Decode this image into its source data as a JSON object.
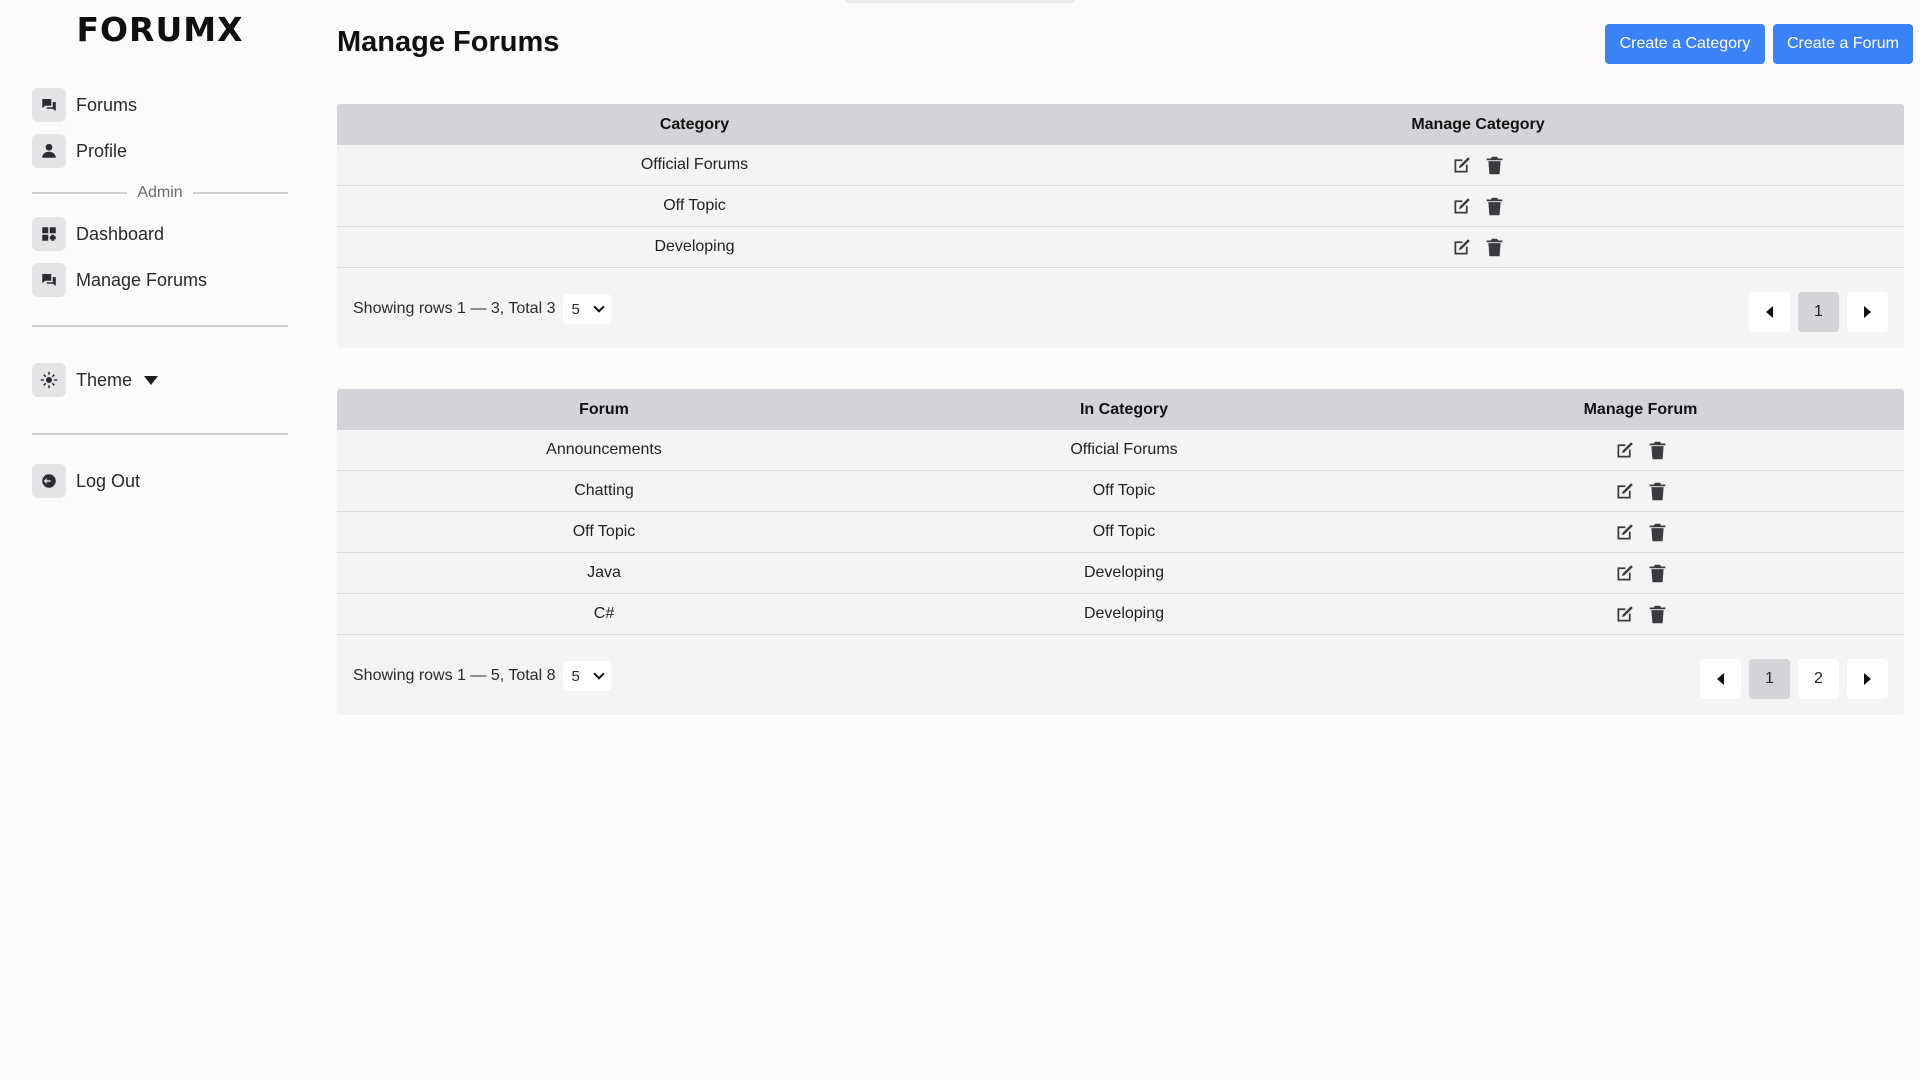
{
  "app": {
    "logo": "FORUMX"
  },
  "sidebar": {
    "items": [
      {
        "label": "Forums",
        "icon": "forums-icon"
      },
      {
        "label": "Profile",
        "icon": "user-icon"
      }
    ],
    "admin_label": "Admin",
    "admin_items": [
      {
        "label": "Dashboard",
        "icon": "dashboard-icon"
      },
      {
        "label": "Manage Forums",
        "icon": "forums-icon"
      }
    ],
    "theme_label": "Theme",
    "logout_label": "Log Out"
  },
  "header": {
    "title": "Manage Forums",
    "create_category_label": "Create a Category",
    "create_forum_label": "Create a Forum"
  },
  "categories_table": {
    "columns": [
      "Category",
      "Manage Category"
    ],
    "rows": [
      {
        "category": "Official Forums"
      },
      {
        "category": "Off Topic"
      },
      {
        "category": "Developing"
      }
    ],
    "showing": "Showing rows 1 — 3, Total 3",
    "page_size": "5",
    "pages": [
      "1"
    ],
    "current_page": "1"
  },
  "forums_table": {
    "columns": [
      "Forum",
      "In Category",
      "Manage Forum"
    ],
    "rows": [
      {
        "forum": "Announcements",
        "category": "Official Forums"
      },
      {
        "forum": "Chatting",
        "category": "Off Topic"
      },
      {
        "forum": "Off Topic",
        "category": "Off Topic"
      },
      {
        "forum": "Java",
        "category": "Developing"
      },
      {
        "forum": "C#",
        "category": "Developing"
      }
    ],
    "showing": "Showing rows 1 — 5, Total 8",
    "page_size": "5",
    "pages": [
      "1",
      "2"
    ],
    "current_page": "1"
  },
  "colors": {
    "accent": "#3b82f6",
    "table_header": "#d4d4d8",
    "panel": "#f4f4f5",
    "background": "#fcfbfa"
  }
}
